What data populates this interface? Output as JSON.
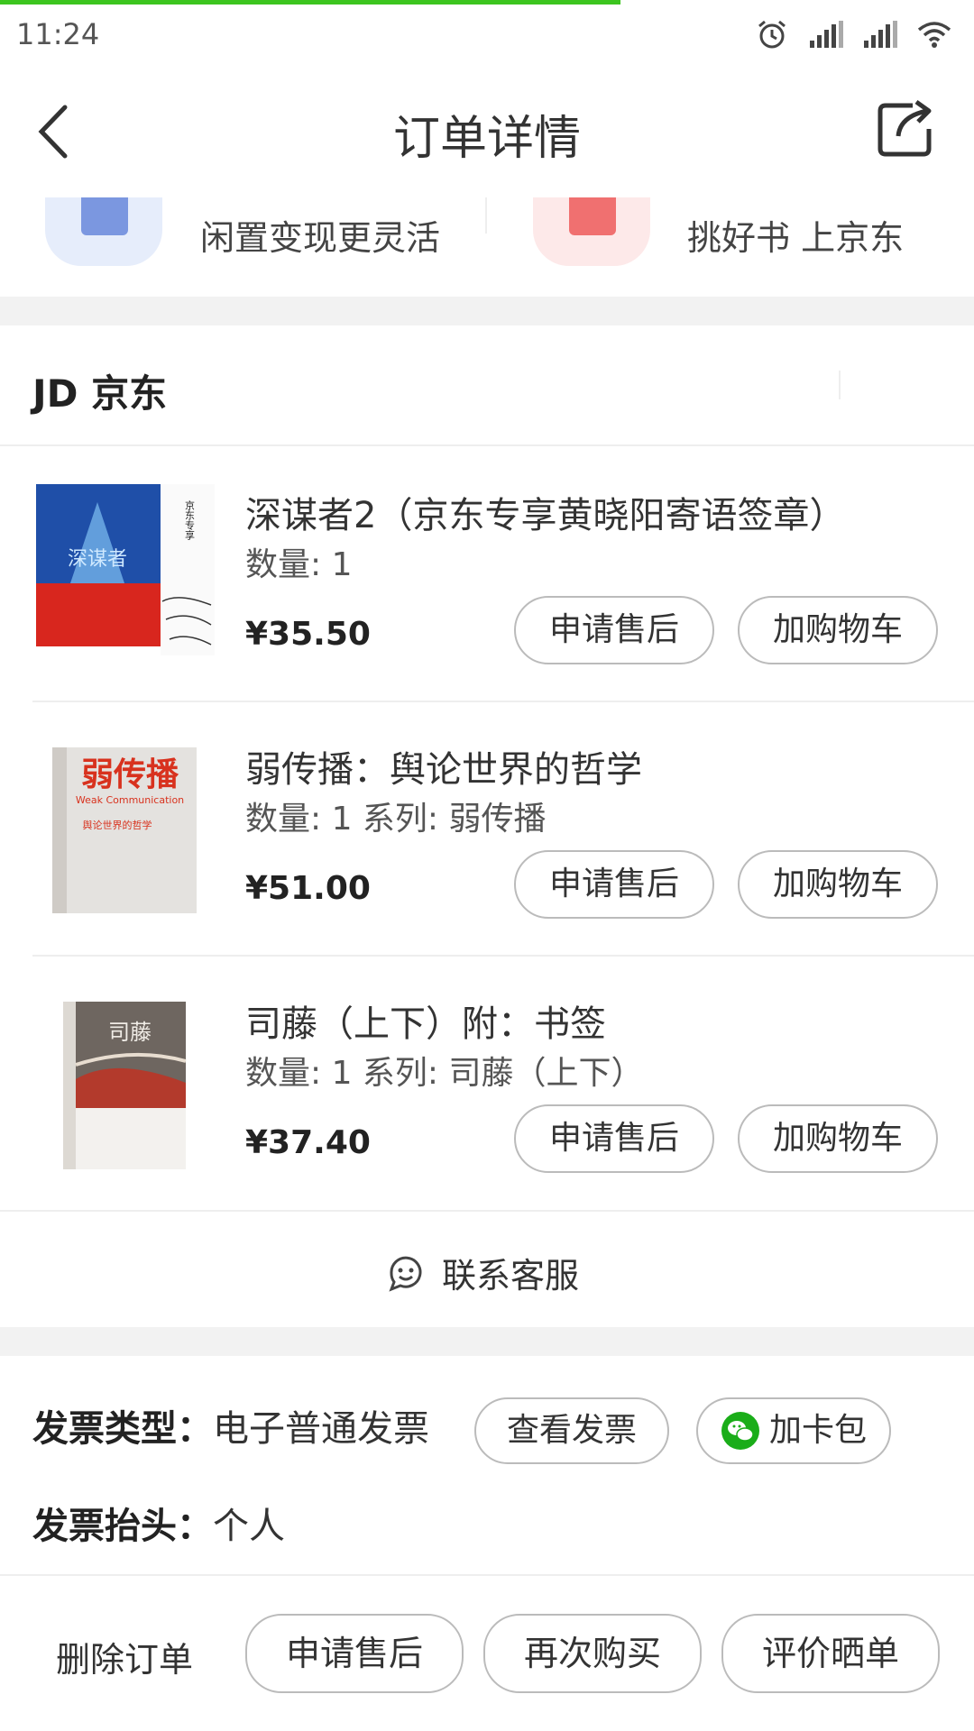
{
  "status_bar": {
    "time": "11:24"
  },
  "header": {
    "title": "订单详情"
  },
  "promo": {
    "left_text": "闲置变现更灵活",
    "right_text": "挑好书 上京东"
  },
  "shop": {
    "name": "JD 京东"
  },
  "items": [
    {
      "name": "深谋者2（京东专享黄晓阳寄语签章）",
      "qty": "数量: 1",
      "price": "¥35.50",
      "after_sale": "申请售后",
      "add_cart": "加购物车",
      "cover_title": "深谋者",
      "cover_side": "京东专享 黄晓阳寄语签章"
    },
    {
      "name": "弱传播：舆论世界的哲学",
      "qty": "数量: 1 系列: 弱传播",
      "price": "¥51.00",
      "after_sale": "申请售后",
      "add_cart": "加购物车",
      "cover_title": "弱传播",
      "cover_sub": "Weak Communication",
      "cover_sub2": "舆论世界的哲学"
    },
    {
      "name": "司藤（上下）附：书签",
      "qty": "数量: 1 系列: 司藤（上下）",
      "price": "¥37.40",
      "after_sale": "申请售后",
      "add_cart": "加购物车",
      "cover_title": "司藤"
    }
  ],
  "service": {
    "label": "联系客服"
  },
  "invoice": {
    "type_label": "发票类型：",
    "type_value": "电子普通发票",
    "view_button": "查看发票",
    "card_button": "加卡包",
    "title_label": "发票抬头：",
    "title_value": "个人"
  },
  "actions": {
    "delete": "删除订单",
    "after_sale": "申请售后",
    "rebuy": "再次购买",
    "review": "评价晒单"
  },
  "colors": {
    "accent_green": "#3cc51f",
    "wechat_green": "#1aad19"
  }
}
